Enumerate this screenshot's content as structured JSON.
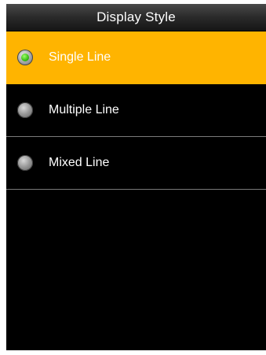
{
  "header": {
    "title": "Display Style"
  },
  "options": [
    {
      "label": "Single Line",
      "selected": true
    },
    {
      "label": "Multiple Line",
      "selected": false
    },
    {
      "label": "Mixed Line",
      "selected": false
    }
  ],
  "colors": {
    "highlight": "#ffb400",
    "background": "#000000",
    "radio_on": "#3fc21a"
  }
}
